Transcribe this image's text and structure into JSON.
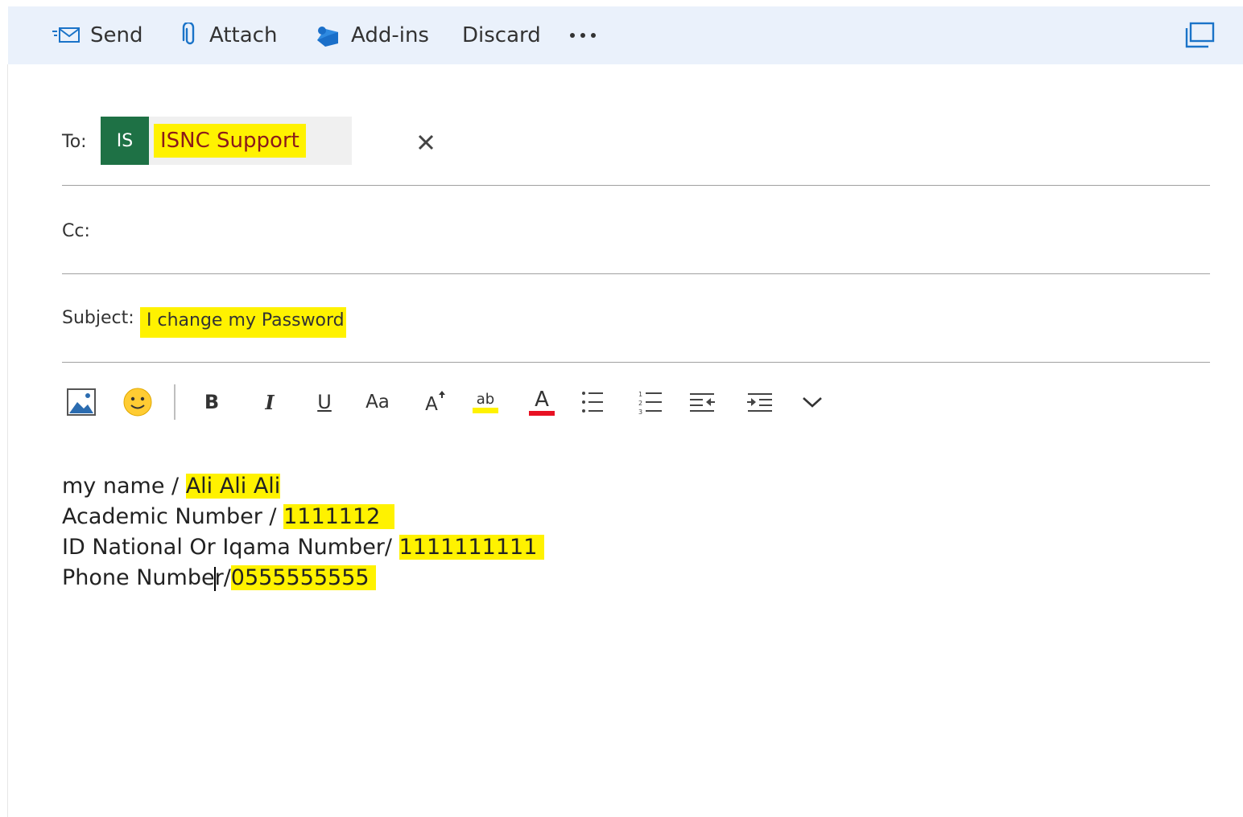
{
  "toolbar": {
    "send_label": "Send",
    "attach_label": "Attach",
    "addins_label": "Add-ins",
    "discard_label": "Discard",
    "more_label": "•••"
  },
  "to": {
    "label": "To:",
    "recipient": {
      "initials": "IS",
      "name": "ISNC Support"
    }
  },
  "cc": {
    "label": "Cc:"
  },
  "subject": {
    "label": "Subject:",
    "value": "I change my Password"
  },
  "format_toolbar": {
    "bold": "B",
    "italic": "I",
    "underline": "U",
    "font_size": "Aa",
    "grow_font": "A",
    "highlight": "ab",
    "font_color": "A"
  },
  "body": {
    "lines": [
      {
        "prefix": "my name / ",
        "value": "Ali Ali Ali"
      },
      {
        "prefix": "Academic Number / ",
        "value": "1111112  "
      },
      {
        "prefix": "ID National Or Iqama Number/ ",
        "value": "1111111111 "
      },
      {
        "prefix_a": "Phone Numbe",
        "prefix_b": "r/",
        "value": "0555555555 "
      }
    ]
  },
  "colors": {
    "highlight": "#fff200",
    "avatar": "#1e7145",
    "toolbar_bg": "#eaf1fb",
    "font_color_bar": "#e81123"
  }
}
